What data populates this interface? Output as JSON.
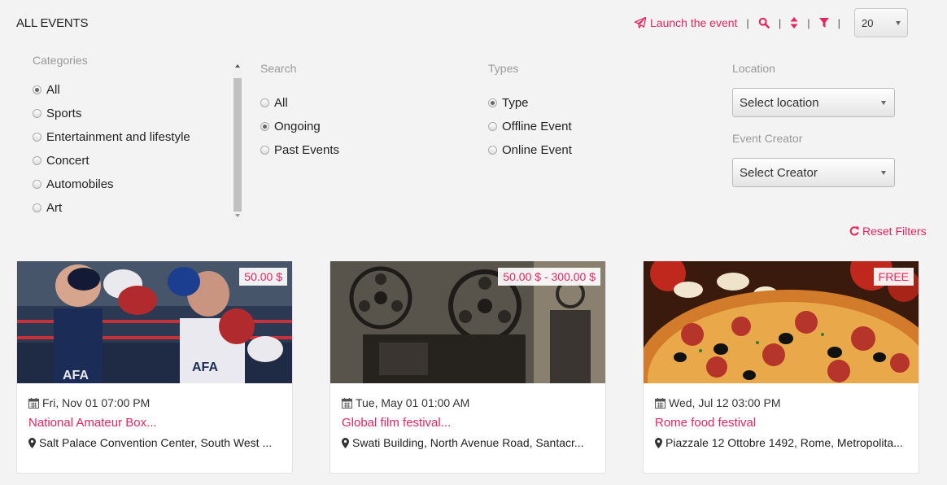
{
  "page": {
    "title": "ALL EVENTS"
  },
  "toolbar": {
    "launch_label": "Launch the event",
    "separator": "|",
    "per_page": "20"
  },
  "categories": {
    "label": "Categories",
    "items": [
      {
        "label": "All",
        "checked": true
      },
      {
        "label": "Sports",
        "checked": false
      },
      {
        "label": "Entertainment and lifestyle",
        "checked": false
      },
      {
        "label": "Concert",
        "checked": false
      },
      {
        "label": "Automobiles",
        "checked": false
      },
      {
        "label": "Art",
        "checked": false
      }
    ]
  },
  "search": {
    "label": "Search",
    "items": [
      {
        "label": "All",
        "checked": false
      },
      {
        "label": "Ongoing",
        "checked": true
      },
      {
        "label": "Past Events",
        "checked": false
      }
    ]
  },
  "types": {
    "label": "Types",
    "items": [
      {
        "label": "Type",
        "checked": true
      },
      {
        "label": "Offline Event",
        "checked": false
      },
      {
        "label": "Online Event",
        "checked": false
      }
    ]
  },
  "location": {
    "label": "Location",
    "value": "Select location"
  },
  "creator": {
    "label": "Event Creator",
    "value": "Select Creator"
  },
  "reset_label": "Reset Filters",
  "events": [
    {
      "price": "50.00  $",
      "date": "Fri, Nov 01 07:00 PM",
      "title": "National Amateur Box...",
      "location": "Salt Palace Convention Center, South West ..."
    },
    {
      "price": "50.00  $ -  300.00  $",
      "date": "Tue, May 01 01:00 AM",
      "title": "Global film festival...",
      "location": "Swati Building, North Avenue Road, Santacr..."
    },
    {
      "price": "FREE",
      "date": "Wed, Jul 12 03:00 PM",
      "title": "Rome food festival",
      "location": "Piazzale 12 Ottobre 1492, Rome, Metropolita..."
    }
  ],
  "colors": {
    "accent": "#e8245f",
    "background": "#f3f3f3"
  }
}
